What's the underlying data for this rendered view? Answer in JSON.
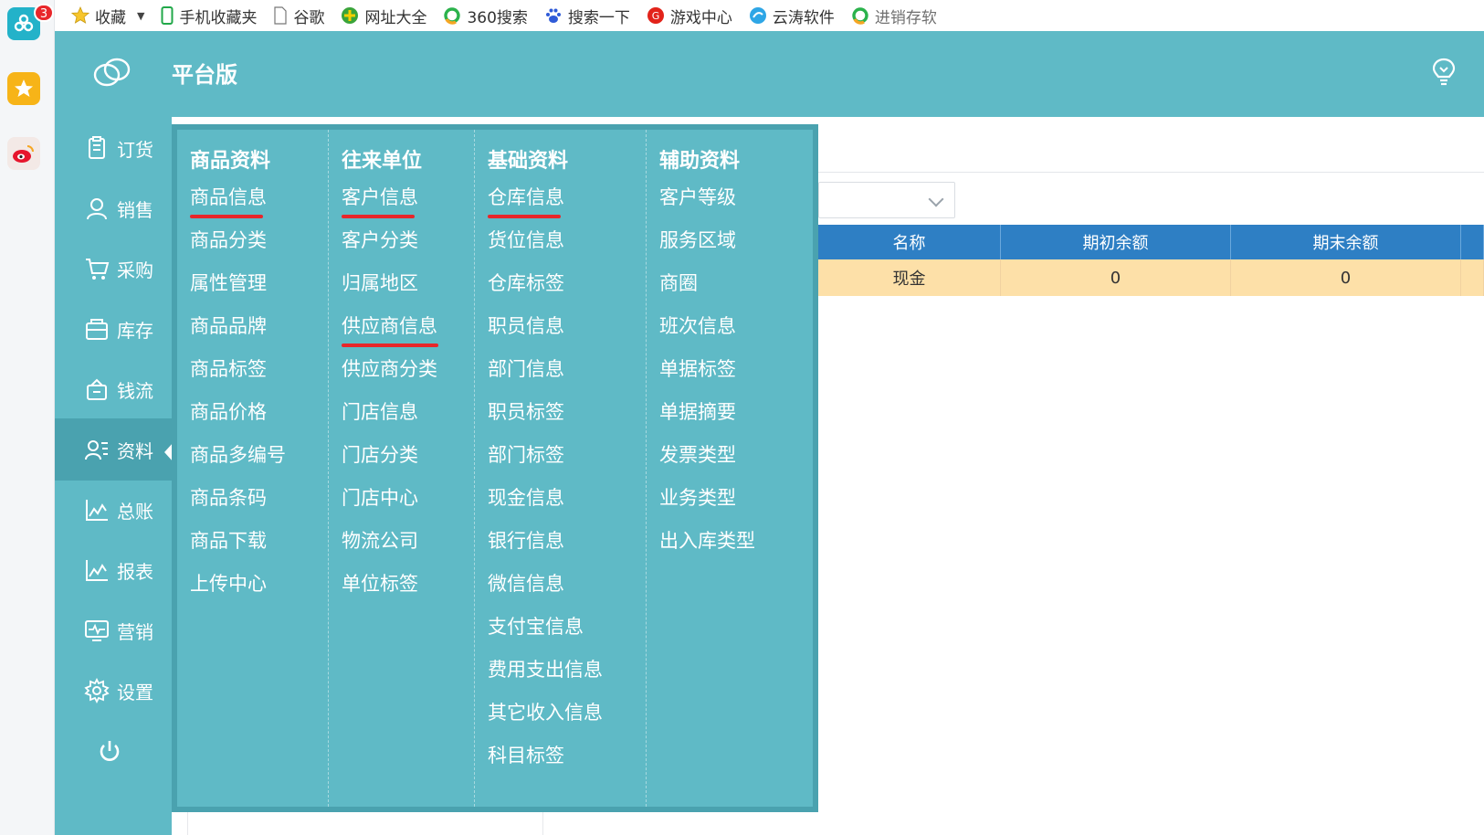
{
  "browser": {
    "dock_badge": "3",
    "bookmarks": [
      {
        "label": "收藏",
        "icon": "star-icon"
      },
      {
        "label": "手机收藏夹",
        "icon": "phone-icon"
      },
      {
        "label": "谷歌",
        "icon": "page-icon"
      },
      {
        "label": "网址大全",
        "icon": "plus-globe-icon"
      },
      {
        "label": "360搜索",
        "icon": "360-search-icon"
      },
      {
        "label": "搜索一下",
        "icon": "paw-icon"
      },
      {
        "label": "游戏中心",
        "icon": "game-icon"
      },
      {
        "label": "云涛软件",
        "icon": "cloud-icon"
      },
      {
        "label": "进销存软",
        "icon": "360-search-icon"
      }
    ]
  },
  "app": {
    "title": "平台版",
    "colors": {
      "primary": "#5fbac6",
      "active": "#4aa2af",
      "table_header": "#2e7fc4",
      "row_highlight": "#fde0a8",
      "underline": "#e8262a"
    }
  },
  "nav": [
    {
      "label": "订货",
      "icon": "clipboard-icon"
    },
    {
      "label": "销售",
      "icon": "user-icon"
    },
    {
      "label": "采购",
      "icon": "cart-icon"
    },
    {
      "label": "库存",
      "icon": "box-icon"
    },
    {
      "label": "钱流",
      "icon": "money-icon"
    },
    {
      "label": "资料",
      "icon": "contacts-icon"
    },
    {
      "label": "总账",
      "icon": "chart-icon"
    },
    {
      "label": "报表",
      "icon": "chart-icon"
    },
    {
      "label": "营销",
      "icon": "monitor-icon"
    },
    {
      "label": "设置",
      "icon": "gear-icon"
    }
  ],
  "menu": {
    "columns": [
      {
        "title": "商品资料",
        "items": [
          "商品信息",
          "商品分类",
          "属性管理",
          "商品品牌",
          "商品标签",
          "商品价格",
          "商品多编号",
          "商品条码",
          "商品下载",
          "上传中心"
        ]
      },
      {
        "title": "往来单位",
        "items": [
          "客户信息",
          "客户分类",
          "归属地区",
          "供应商信息",
          "供应商分类",
          "门店信息",
          "门店分类",
          "门店中心",
          "物流公司",
          "单位标签"
        ]
      },
      {
        "title": "基础资料",
        "items": [
          "仓库信息",
          "货位信息",
          "仓库标签",
          "职员信息",
          "部门信息",
          "职员标签",
          "部门标签",
          "现金信息",
          "银行信息",
          "微信信息",
          "支付宝信息",
          "费用支出信息",
          "其它收入信息",
          "科目标签"
        ]
      },
      {
        "title": "辅助资料",
        "items": [
          "客户等级",
          "服务区域",
          "商圈",
          "班次信息",
          "单据标签",
          "单据摘要",
          "发票类型",
          "业务类型",
          "出入库类型"
        ]
      }
    ]
  },
  "table": {
    "headers": [
      "名称",
      "期初余额",
      "期末余额"
    ],
    "rows": [
      [
        "现金",
        "0",
        "0"
      ]
    ]
  }
}
